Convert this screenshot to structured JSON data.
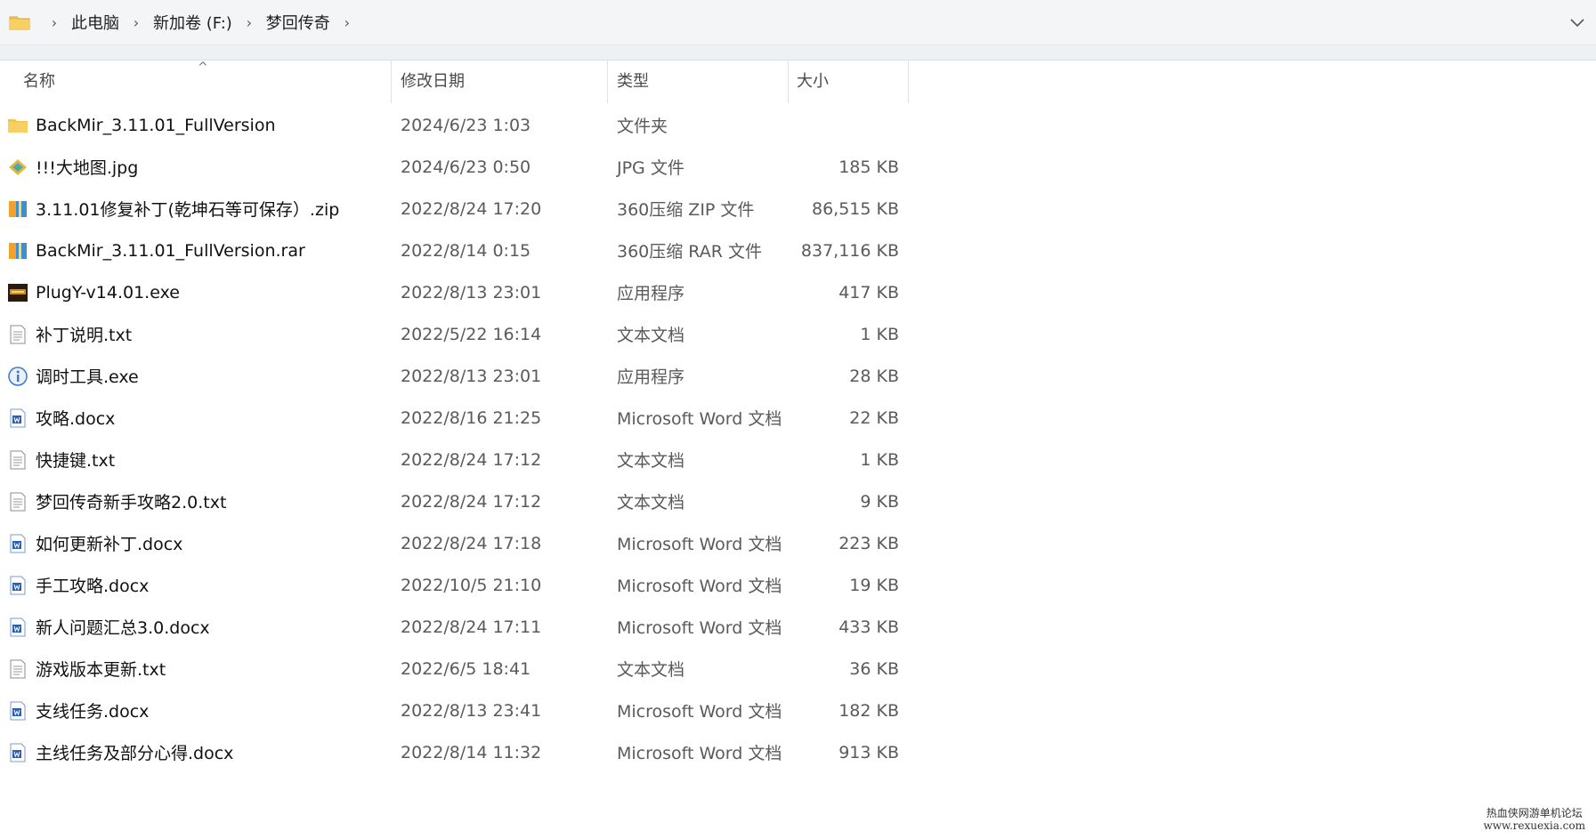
{
  "breadcrumb": [
    "此电脑",
    "新加卷 (F:)",
    "梦回传奇"
  ],
  "columns": {
    "name": "名称",
    "date": "修改日期",
    "type": "类型",
    "size": "大小"
  },
  "files": [
    {
      "name": "BackMir_3.11.01_FullVersion",
      "date": "2024/6/23 1:03",
      "type": "文件夹",
      "size": "",
      "icon": "folder-icon"
    },
    {
      "name": "!!!大地图.jpg",
      "date": "2024/6/23 0:50",
      "type": "JPG 文件",
      "size": "185 KB",
      "icon": "image-file-icon"
    },
    {
      "name": "3.11.01修复补丁(乾坤石等可保存）.zip",
      "date": "2022/8/24 17:20",
      "type": "360压缩 ZIP 文件",
      "size": "86,515 KB",
      "icon": "archive-icon"
    },
    {
      "name": "BackMir_3.11.01_FullVersion.rar",
      "date": "2022/8/14 0:15",
      "type": "360压缩 RAR 文件",
      "size": "837,116 KB",
      "icon": "archive-icon"
    },
    {
      "name": "PlugY-v14.01.exe",
      "date": "2022/8/13 23:01",
      "type": "应用程序",
      "size": "417 KB",
      "icon": "app-exe-icon"
    },
    {
      "name": "补丁说明.txt",
      "date": "2022/5/22 16:14",
      "type": "文本文档",
      "size": "1 KB",
      "icon": "text-file-icon"
    },
    {
      "name": "调时工具.exe",
      "date": "2022/8/13 23:01",
      "type": "应用程序",
      "size": "28 KB",
      "icon": "info-app-icon"
    },
    {
      "name": "攻略.docx",
      "date": "2022/8/16 21:25",
      "type": "Microsoft Word 文档",
      "size": "22 KB",
      "icon": "word-doc-icon"
    },
    {
      "name": "快捷键.txt",
      "date": "2022/8/24 17:12",
      "type": "文本文档",
      "size": "1 KB",
      "icon": "text-file-icon"
    },
    {
      "name": "梦回传奇新手攻略2.0.txt",
      "date": "2022/8/24 17:12",
      "type": "文本文档",
      "size": "9 KB",
      "icon": "text-file-icon"
    },
    {
      "name": "如何更新补丁.docx",
      "date": "2022/8/24 17:18",
      "type": "Microsoft Word 文档",
      "size": "223 KB",
      "icon": "word-doc-icon"
    },
    {
      "name": "手工攻略.docx",
      "date": "2022/10/5 21:10",
      "type": "Microsoft Word 文档",
      "size": "19 KB",
      "icon": "word-doc-icon"
    },
    {
      "name": "新人问题汇总3.0.docx",
      "date": "2022/8/24 17:11",
      "type": "Microsoft Word 文档",
      "size": "433 KB",
      "icon": "word-doc-icon"
    },
    {
      "name": "游戏版本更新.txt",
      "date": "2022/6/5 18:41",
      "type": "文本文档",
      "size": "36 KB",
      "icon": "text-file-icon"
    },
    {
      "name": "支线任务.docx",
      "date": "2022/8/13 23:41",
      "type": "Microsoft Word 文档",
      "size": "182 KB",
      "icon": "word-doc-icon"
    },
    {
      "name": "主线任务及部分心得.docx",
      "date": "2022/8/14 11:32",
      "type": "Microsoft Word 文档",
      "size": "913 KB",
      "icon": "word-doc-icon"
    }
  ],
  "watermark": {
    "line1": "热血侠网游单机论坛",
    "line2": "www.rexuexia.com"
  },
  "colors": {
    "folder": "#f2c14e",
    "word": "#2b5fb4",
    "address_bg": "#f3f5f7"
  }
}
